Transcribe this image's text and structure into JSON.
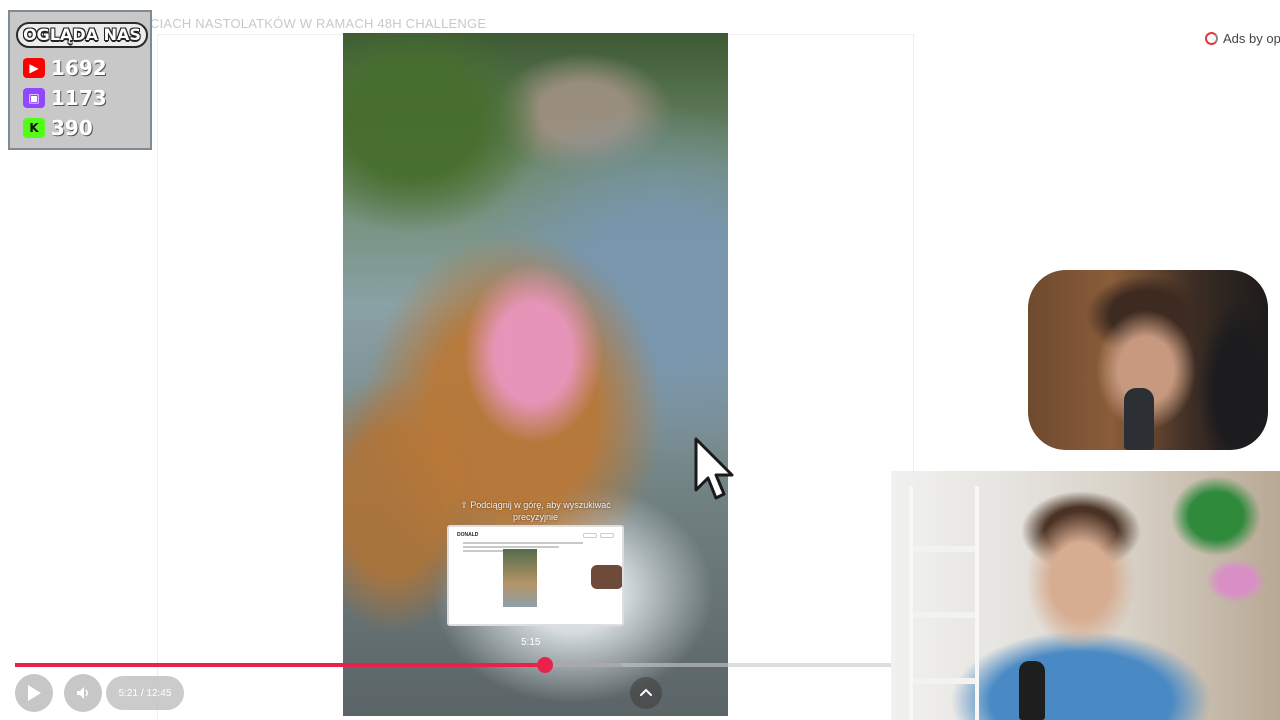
{
  "page": {
    "title_fragment": "CIACH NASTOLATKÓW W RAMACH 48H CHALLENGE",
    "ads_label": "Ads by op"
  },
  "stream_overlay": {
    "title": "OGLĄDA NAS",
    "counters": [
      {
        "platform": "youtube",
        "icon": "youtube-icon",
        "value": "1692",
        "color": "#ff0000"
      },
      {
        "platform": "twitch",
        "icon": "twitch-icon",
        "value": "1173",
        "color": "#9146ff"
      },
      {
        "platform": "kick",
        "icon": "kick-icon",
        "value": "390",
        "color": "#53fc18"
      }
    ]
  },
  "video": {
    "swipe_hint": "⇧ Podciągnij w górę, aby wyszukiwać precyzyjnie",
    "preview_logo": "DONALD",
    "preview_time": "5:15",
    "time_display": "5:21 / 12:45",
    "progress_fraction": 0.6046,
    "accent_color": "#e8224a"
  },
  "controls": {
    "play_icon": "play-icon",
    "volume_icon": "volume-icon",
    "expand_icon": "chevron-up-icon"
  }
}
